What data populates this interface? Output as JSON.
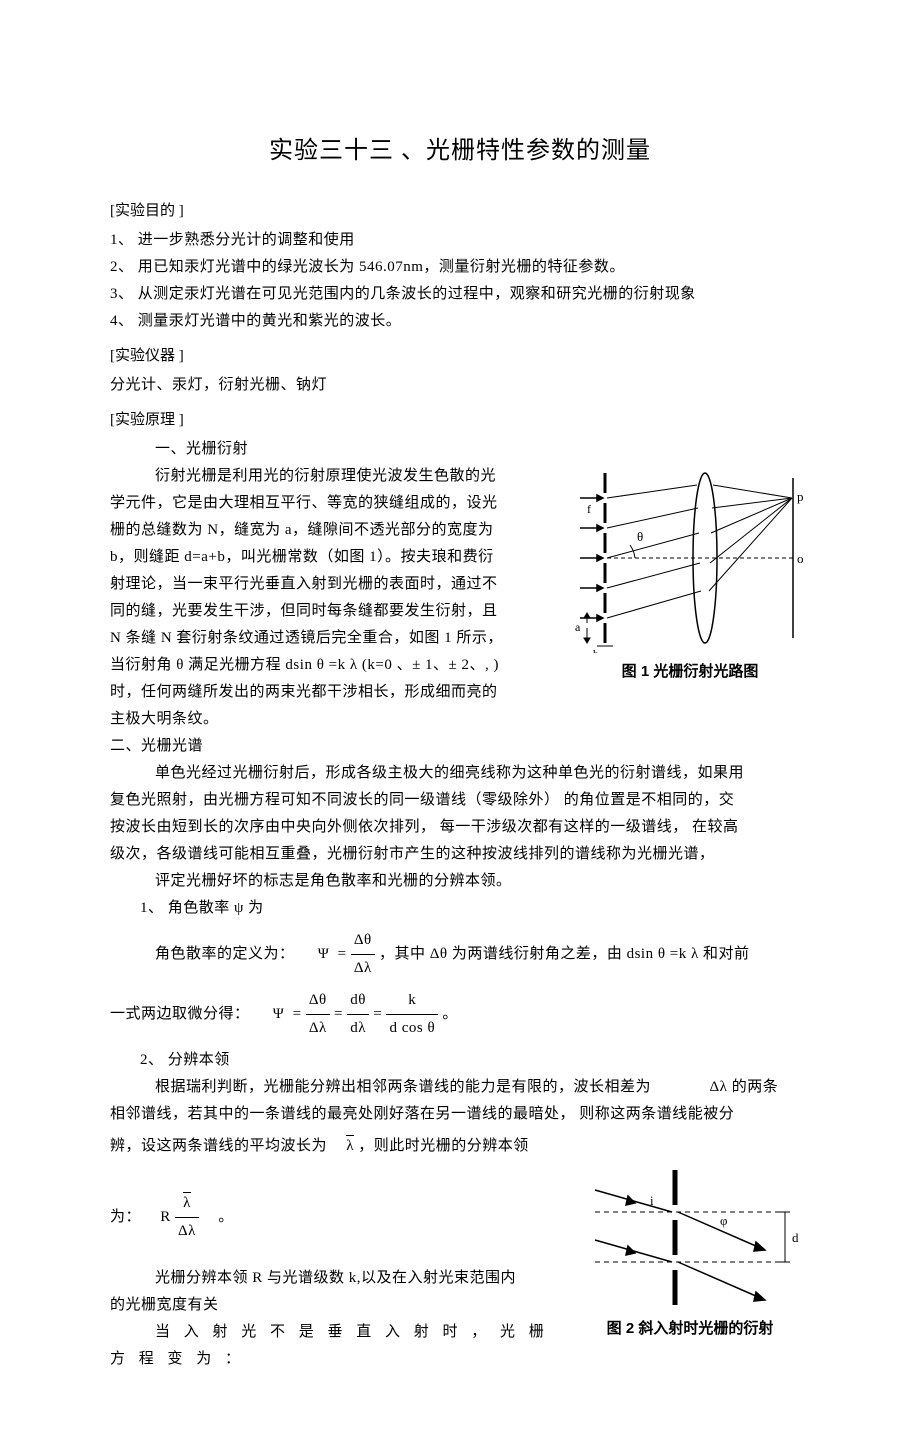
{
  "title": "实验三十三  、光栅特性参数的测量",
  "purpose": {
    "header": "[实验目的 ]",
    "items": [
      "1、 进一步熟悉分光计的调整和使用",
      "2、 用已知汞灯光谱中的绿光波长为     546.07nm，测量衍射光栅的特征参数。",
      "3、 从测定汞灯光谱在可见光范围内的几条波长的过程中，观察和研究光栅的衍射现象",
      "4、 测量汞灯光谱中的黄光和紫光的波长。"
    ]
  },
  "apparatus": {
    "header": "[实验仪器 ]",
    "text": "分光计、汞灯，衍射光栅、钠灯"
  },
  "principle": {
    "header": "[实验原理 ]",
    "sub1": "一、光栅衍射",
    "p1_a": "衍射光栅是利用光的衍射原理使光波发生色散的光",
    "p1_b": "学元件，它是由大理相互平行、等宽的狭缝组成的，设光",
    "p1_c": "栅的总缝数为   N，缝宽为  a，缝隙间不透光部分的宽度为",
    "p1_d": "b，则缝距   d=a+b，叫光栅常数（如图     1）。按夫琅和费衍",
    "p1_e": "射理论，当一束平行光垂直入射到光栅的表面时，通过不",
    "p1_f": "同的缝，光要发生干涉，但同时每条缝都要发生衍射，且",
    "p1_g": "N 条缝  N 套衍射条纹通过透镜后完全重合，如图      1 所示，",
    "p1_h": "当衍射角   θ 满足光栅方程    dsin θ =k λ (k=0 、± 1、± 2、, )",
    "p1_i": "时，任何两缝所发出的两束光都干涉相长，形成细而亮的",
    "p1_j": "主极大明条纹。",
    "fig1_caption": "图 1 光栅衍射光路图",
    "sub2": "二、光栅光谱",
    "p2_a": "单色光经过光栅衍射后，形成各级主极大的细亮线称为这种单色光的衍射谱线，如果用",
    "p2_b": "复色光照射，由光栅方程可知不同波长的同一级谱线（零级除外）          的角位置是不相同的，交",
    "p2_c": "按波长由短到长的次序由中央向外侧依次排列，       每一干涉级次都有这样的一级谱线，       在较高",
    "p2_d": "级次，各级谱线可能相互重叠，光栅衍射市产生的这种按波线排列的谱线称为光栅光谱，",
    "p2_e": "评定光栅好坏的标志是角色散率和光栅的分辨本领。",
    "item1": "1、 角色散率   ψ 为",
    "f1_pre": "角色散率的定义为：",
    "f1_mid": "，其中",
    "f1_post": "为两谱线衍射角之差，由      dsin θ =k λ 和对前",
    "f1b_pre": "一式两边取微分得：",
    "item2": "2、 分辨本领",
    "p3_a": "根据瑞利判断，光栅能分辨出相邻两条谱线的能力是有限的，波长相差为",
    "p3_a2": "的两条",
    "p3_b": "相邻谱线，若其中的一条谱线的最亮处刚好落在另一谱线的最暗处，        则称这两条谱线能被分",
    "p3_c_pre": "辨，设这两条谱线的平均波长为",
    "p3_c_post": "，则此时光栅的分辨本领",
    "f2_pre": "为：",
    "f2_post": "。",
    "p4_a": "光栅分辨本领    R 与光谱级数   k,以及在入射光束范围内",
    "p4_b": "的光栅宽度有关",
    "p4_c": "当 入 射 光 不 是 垂 直 入 射 时 ， 光 栅 方 程 变 为 ：",
    "fig2_caption": "图 2 斜入射时光栅的衍射",
    "psi": "Ψ",
    "eq": "=",
    "dtheta": "Δθ",
    "dlambda": "Δλ",
    "dthetad": "dθ",
    "dlambdad": "dλ",
    "k": "k",
    "dcos": "d cos θ",
    "R": "R",
    "lambda": "λ",
    "barlambda": "λ"
  }
}
